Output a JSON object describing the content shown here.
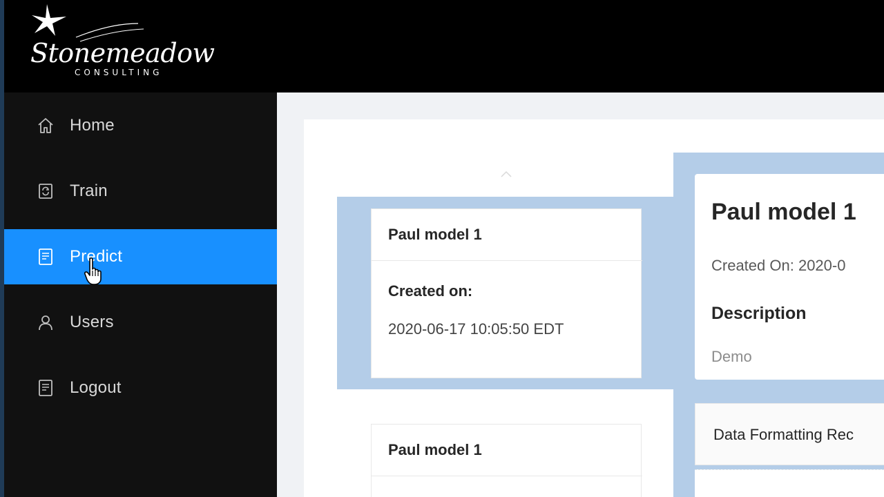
{
  "brand": {
    "name": "Stonemeadow",
    "tagline": "CONSULTING"
  },
  "sidebar": {
    "items": [
      {
        "label": "Home",
        "icon": "home-icon"
      },
      {
        "label": "Train",
        "icon": "train-icon"
      },
      {
        "label": "Predict",
        "icon": "predict-icon",
        "active": true
      },
      {
        "label": "Users",
        "icon": "user-icon"
      },
      {
        "label": "Logout",
        "icon": "logout-icon"
      }
    ]
  },
  "models": [
    {
      "name": "Paul model 1",
      "created_label": "Created on:",
      "created_value": "2020-06-17 10:05:50 EDT",
      "selected": true
    },
    {
      "name": "Paul model 1"
    }
  ],
  "detail": {
    "title": "Paul model 1",
    "created": "Created On:  2020-0",
    "description_heading": "Description",
    "description": "Demo",
    "format_section": "Data Formatting Rec"
  },
  "colors": {
    "active": "#1890ff",
    "highlight": "#b4cde8",
    "sidebar_bg": "#111111"
  }
}
